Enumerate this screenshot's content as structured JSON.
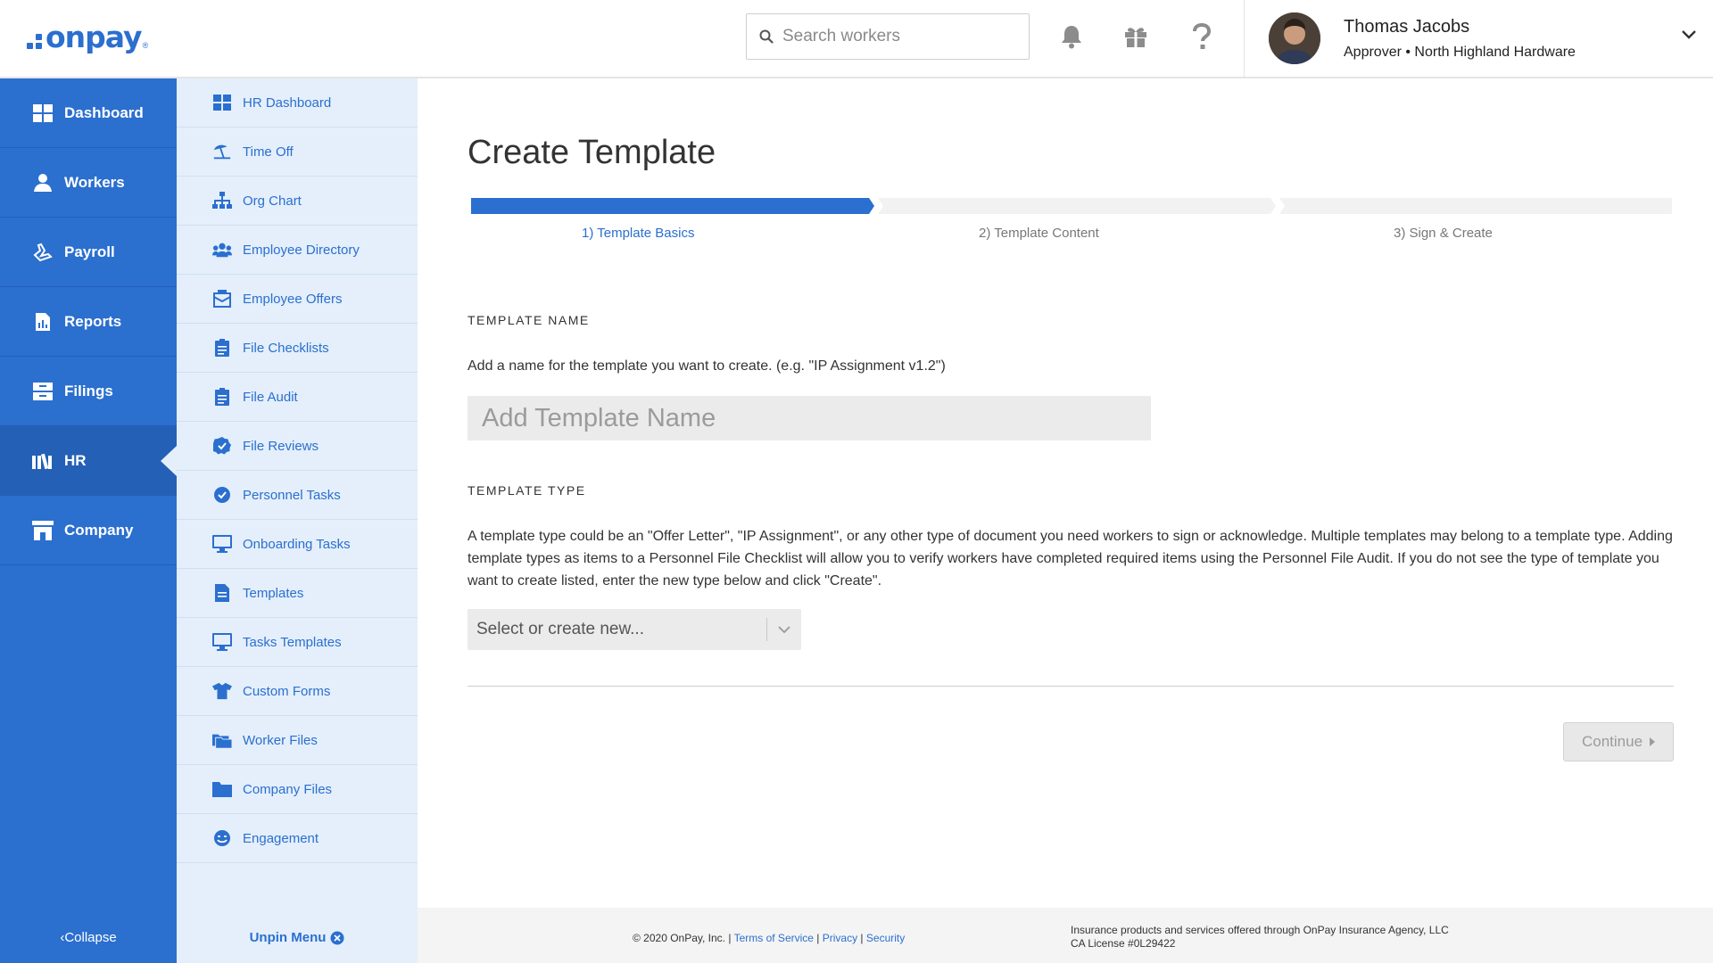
{
  "brand": {
    "logo_text": "onpay",
    "accent": "#2b6fcf",
    "sidebar_bg": "#2b6fcf",
    "subnav_bg": "#e4effb"
  },
  "header": {
    "search_placeholder": "Search workers",
    "icons": [
      "bell-icon",
      "gift-icon",
      "question-icon"
    ],
    "user": {
      "name": "Thomas Jacobs",
      "role": "Approver • North Highland Hardware"
    }
  },
  "sidebar": {
    "items": [
      {
        "label": "Dashboard",
        "icon": "dashboard-icon"
      },
      {
        "label": "Workers",
        "icon": "workers-icon"
      },
      {
        "label": "Payroll",
        "icon": "payroll-icon"
      },
      {
        "label": "Reports",
        "icon": "reports-icon"
      },
      {
        "label": "Filings",
        "icon": "filings-icon"
      },
      {
        "label": "HR",
        "icon": "hr-icon",
        "active": true
      },
      {
        "label": "Company",
        "icon": "company-icon"
      }
    ],
    "collapse_label": "Collapse"
  },
  "subnav": {
    "items": [
      {
        "label": "HR Dashboard",
        "icon": "grid-icon"
      },
      {
        "label": "Time Off",
        "icon": "beach-umbrella-icon"
      },
      {
        "label": "Org Chart",
        "icon": "org-chart-icon"
      },
      {
        "label": "Employee Directory",
        "icon": "people-icon"
      },
      {
        "label": "Employee Offers",
        "icon": "offer-icon"
      },
      {
        "label": "File Checklists",
        "icon": "clipboard-icon"
      },
      {
        "label": "File Audit",
        "icon": "clipboard-icon"
      },
      {
        "label": "File Reviews",
        "icon": "check-badge-icon"
      },
      {
        "label": "Personnel Tasks",
        "icon": "check-circle-icon"
      },
      {
        "label": "Onboarding Tasks",
        "icon": "monitor-icon"
      },
      {
        "label": "Templates",
        "icon": "document-icon"
      },
      {
        "label": "Tasks Templates",
        "icon": "monitor-icon"
      },
      {
        "label": "Custom Forms",
        "icon": "shirt-icon"
      },
      {
        "label": "Worker Files",
        "icon": "folders-icon"
      },
      {
        "label": "Company Files",
        "icon": "folder-icon"
      },
      {
        "label": "Engagement",
        "icon": "smile-icon"
      }
    ],
    "unpin_label": "Unpin Menu"
  },
  "main": {
    "title": "Create Template",
    "steps": [
      {
        "label": "1) Template Basics",
        "active": true
      },
      {
        "label": "2) Template Content",
        "active": false
      },
      {
        "label": "3) Sign & Create",
        "active": false
      }
    ],
    "template_name": {
      "label": "TEMPLATE NAME",
      "help": "Add a name for the template you want to create. (e.g. \"IP Assignment v1.2\")",
      "placeholder": "Add Template Name",
      "value": ""
    },
    "template_type": {
      "label": "TEMPLATE TYPE",
      "help": "A template type could be an \"Offer Letter\", \"IP Assignment\", or any other type of document you need workers to sign or acknowledge. Multiple templates may belong to a template type. Adding template types as items to a Personnel File Checklist will allow you to verify workers have completed required items using the Personnel File Audit. If you do not see the type of template you want to create listed, enter the new type below and click \"Create\".",
      "select_placeholder": "Select or create new..."
    },
    "continue_label": "Continue"
  },
  "footer": {
    "copyright": "© 2020 OnPay, Inc. |",
    "links": [
      "Terms of Service",
      "Privacy",
      "Security"
    ],
    "insurance_line1": "Insurance products and services offered through OnPay Insurance Agency, LLC",
    "insurance_line2": "CA License #0L29422"
  }
}
